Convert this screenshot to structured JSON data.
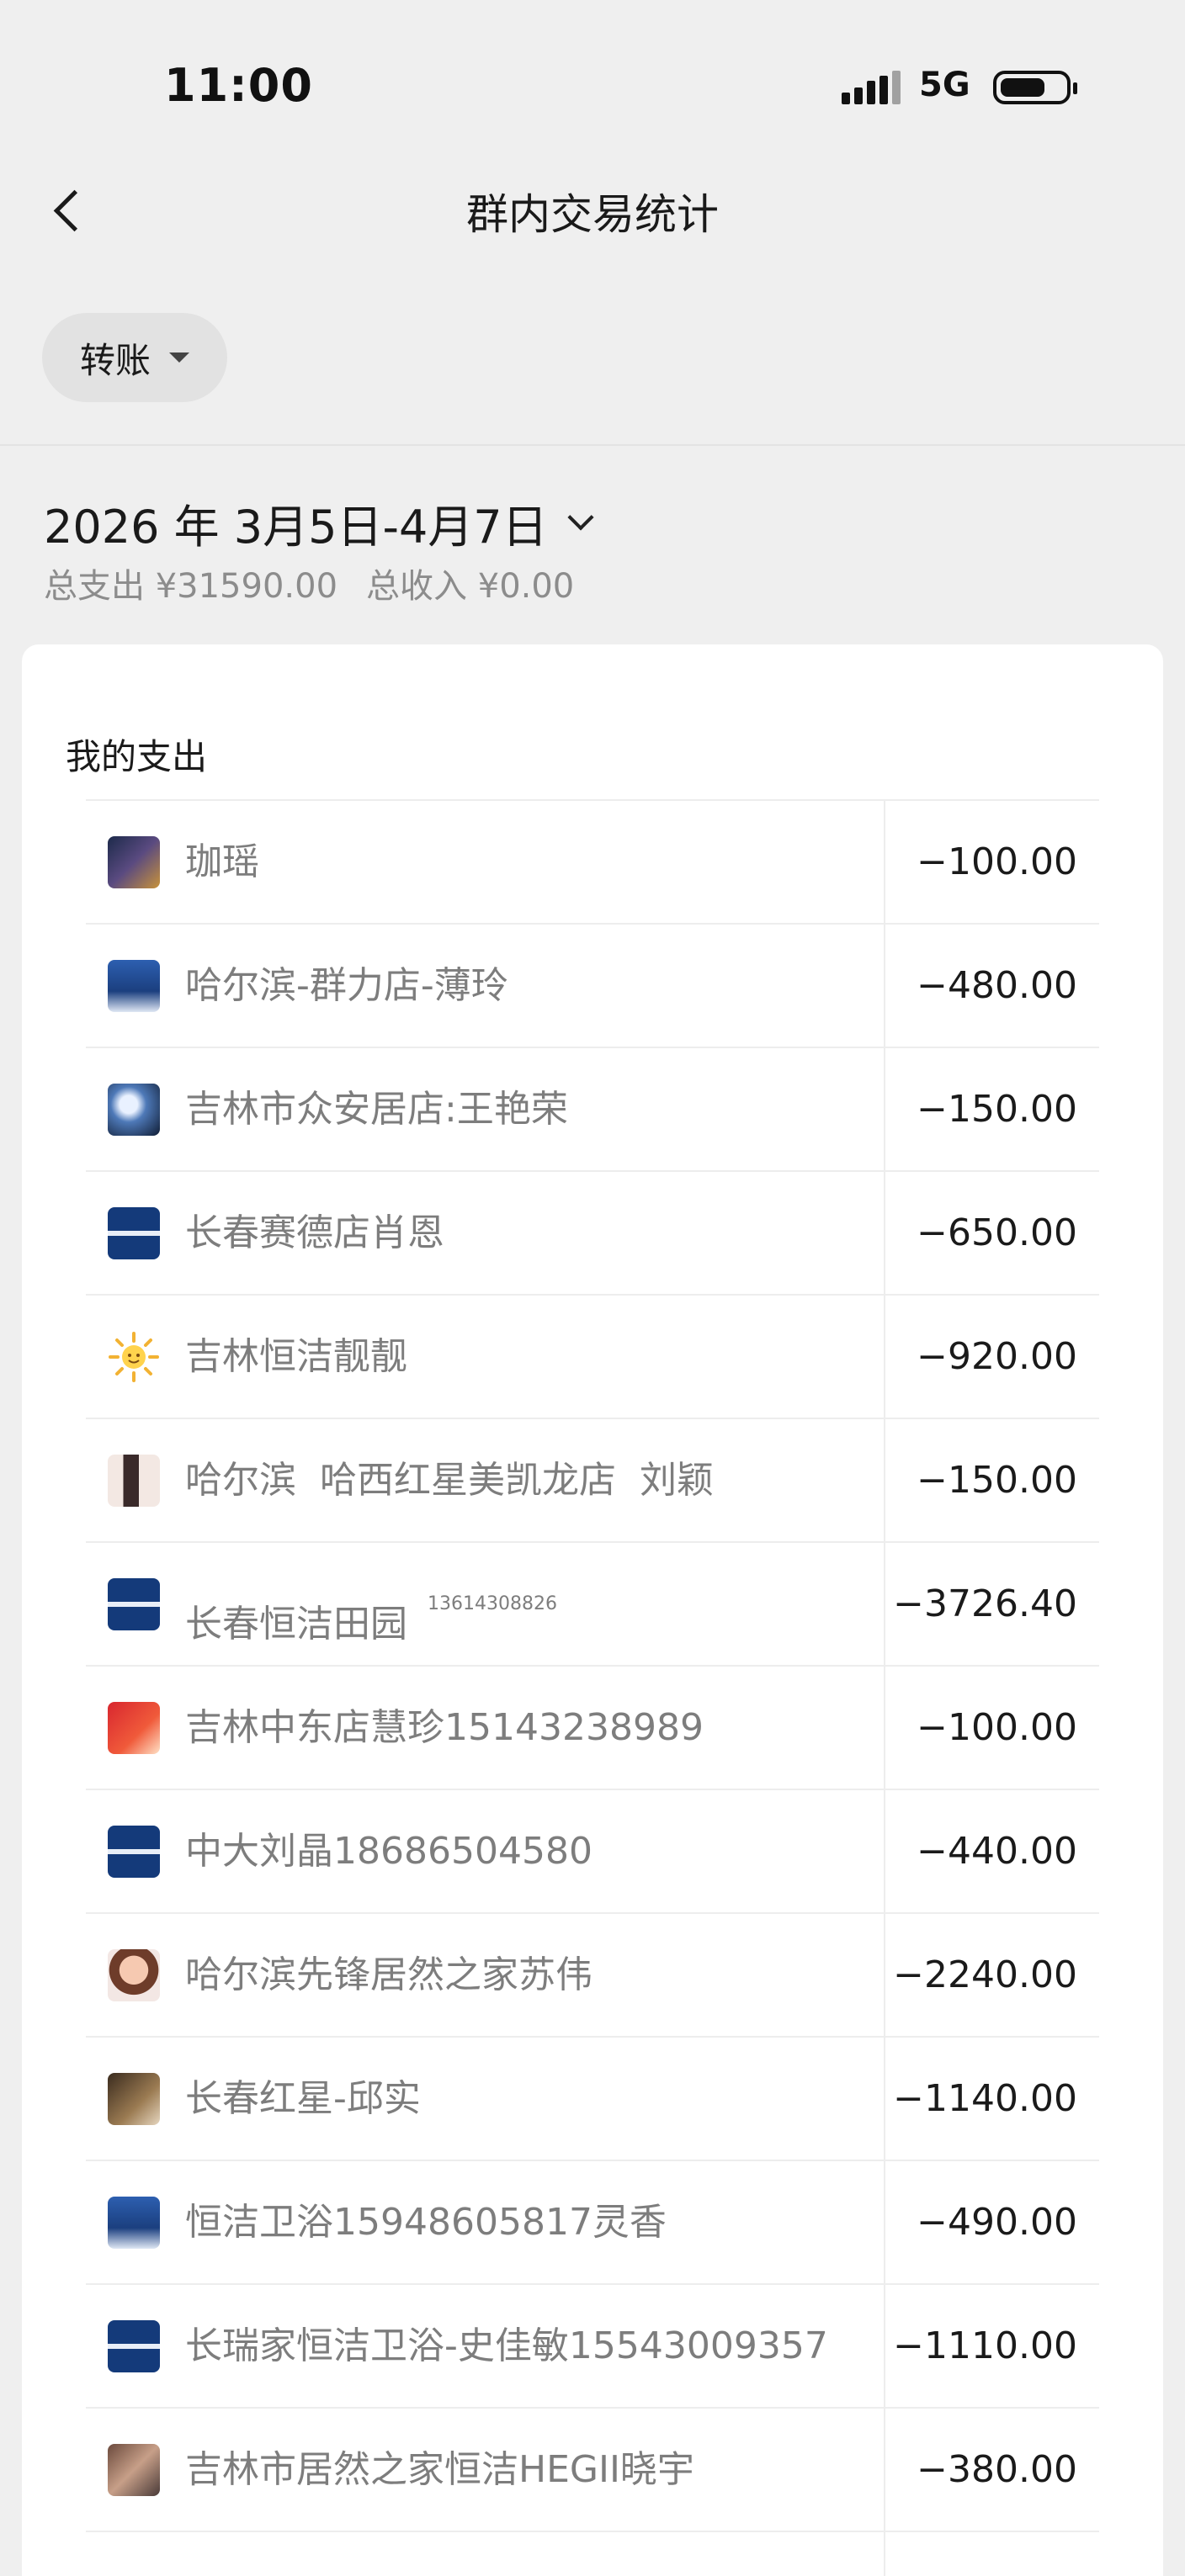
{
  "status_bar": {
    "time": "11:00",
    "network": "5G"
  },
  "nav": {
    "title": "群内交易统计"
  },
  "filter": {
    "label": "转账"
  },
  "date_range": {
    "label": "2026 年 3月5日-4月7日"
  },
  "summary": {
    "total_expense": "总支出 ¥31590.00",
    "total_income": "总收入 ¥0.00"
  },
  "card": {
    "title": "我的支出"
  },
  "rows": [
    {
      "name": "珈瑶",
      "note": "",
      "amount": "−100.00",
      "avatar": "portrait"
    },
    {
      "name": "哈尔滨-群力店-薄玲",
      "note": "",
      "amount": "−480.00",
      "avatar": "blue"
    },
    {
      "name": "吉林市众安居店:王艳荣",
      "note": "",
      "amount": "−150.00",
      "avatar": "space"
    },
    {
      "name": "长春赛德店肖恩",
      "note": "",
      "amount": "−650.00",
      "avatar": "navy"
    },
    {
      "name": "吉林恒洁靓靓",
      "note": "",
      "amount": "−920.00",
      "avatar": "sun"
    },
    {
      "name": "哈尔滨  哈西红星美凯龙店  刘颖",
      "note": "",
      "amount": "−150.00",
      "avatar": "legs"
    },
    {
      "name": "长春恒洁田园",
      "note": "13614308826",
      "amount": "−3726.40",
      "avatar": "navy"
    },
    {
      "name": "吉林中东店慧珍15143238989",
      "note": "",
      "amount": "−100.00",
      "avatar": "red"
    },
    {
      "name": "中大刘晶18686504580",
      "note": "",
      "amount": "−440.00",
      "avatar": "navy"
    },
    {
      "name": "哈尔滨先锋居然之家苏伟",
      "note": "",
      "amount": "−2240.00",
      "avatar": "cartoon"
    },
    {
      "name": "长春红星-邱实",
      "note": "",
      "amount": "−1140.00",
      "avatar": "shop"
    },
    {
      "name": "恒洁卫浴15948605817灵香",
      "note": "",
      "amount": "−490.00",
      "avatar": "blue"
    },
    {
      "name": "长瑞家恒洁卫浴-史佳敏15543009357",
      "note": "",
      "amount": "−1110.00",
      "avatar": "navy"
    },
    {
      "name": "吉林市居然之家恒洁HEGII晓宇",
      "note": "",
      "amount": "−380.00",
      "avatar": "photo"
    }
  ]
}
